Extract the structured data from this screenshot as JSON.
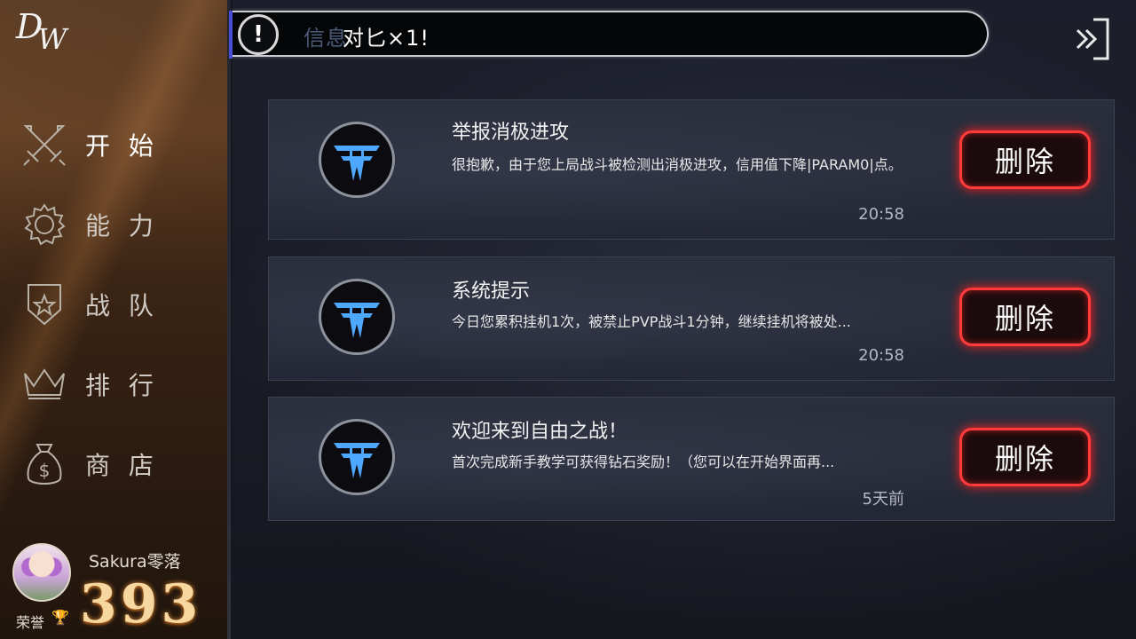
{
  "logo": {
    "text_top": "D",
    "text_bottom": "W"
  },
  "sidebar": {
    "items": [
      {
        "label": "开 始",
        "icon": "crossed-swords-icon",
        "active": true
      },
      {
        "label": "能 力",
        "icon": "gear-icon",
        "active": false
      },
      {
        "label": "战 队",
        "icon": "shield-star-icon",
        "active": false
      },
      {
        "label": "排 行",
        "icon": "crown-icon",
        "active": false
      },
      {
        "label": "商 店",
        "icon": "money-bag-icon",
        "active": false
      }
    ]
  },
  "profile": {
    "username": "Sakura零落",
    "honor_label": "荣誉",
    "honor_icon": "trophy-icon",
    "honor_value": "393"
  },
  "notice": {
    "icon": "exclamation-icon",
    "faded_text": "信息",
    "text": "对匕×1!"
  },
  "header": {
    "exit_icon": "exit-icon"
  },
  "messages": [
    {
      "title": "举报消极进攻",
      "body": "很抱歉，由于您上局战斗被检测出消极进攻，信用值下降|PARAM0|点。",
      "time": "20:58",
      "delete_label": "删除",
      "logo": "game-logo-icon"
    },
    {
      "title": "系统提示",
      "body": "今日您累积挂机1次，被禁止PVP战斗1分钟，继续挂机将被处...",
      "time": "20:58",
      "delete_label": "删除",
      "logo": "game-logo-icon"
    },
    {
      "title": "欢迎来到自由之战！",
      "body": "首次完成新手教学可获得钻石奖励！（您可以在开始界面再...",
      "time": "5天前",
      "delete_label": "删除",
      "logo": "game-logo-icon"
    }
  ],
  "colors": {
    "delete_glow": "#ff3b3b",
    "honor_gold": "#f6d7a0",
    "logo_blue": "#4fa8ff"
  }
}
